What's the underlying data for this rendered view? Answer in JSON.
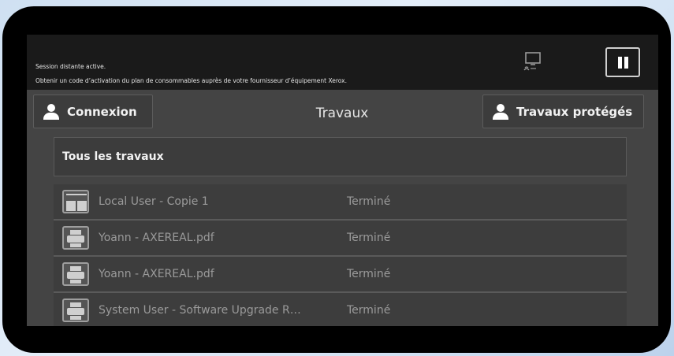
{
  "banner": {
    "line1": "Session distante active.",
    "line2": "Obtenir un code d’activation du plan de consommables auprès de votre fournisseur d’équipement Xerox."
  },
  "icons": {
    "remote": "remote-session-icon",
    "pause": "pause-icon",
    "user": "user-icon",
    "printer": "printer-icon",
    "copy": "copy-icon"
  },
  "header": {
    "login_label": "Connexion",
    "title": "Travaux",
    "protected_label": "Travaux protégés"
  },
  "filter": {
    "label": "Tous les travaux"
  },
  "jobs": [
    {
      "icon": "copy-icon",
      "name": "Local User - Copie 1",
      "status": "Terminé"
    },
    {
      "icon": "printer-icon",
      "name": "Yoann - AXEREAL.pdf",
      "status": "Terminé"
    },
    {
      "icon": "printer-icon",
      "name": "Yoann - AXEREAL.pdf",
      "status": "Terminé"
    },
    {
      "icon": "printer-icon",
      "name": "System User - Software Upgrade R…",
      "status": "Terminé"
    }
  ],
  "colors": {
    "background": "#444444",
    "topbar": "#1a1a1a",
    "text": "#f2f2f2",
    "muted_text": "#9a9a9a"
  }
}
